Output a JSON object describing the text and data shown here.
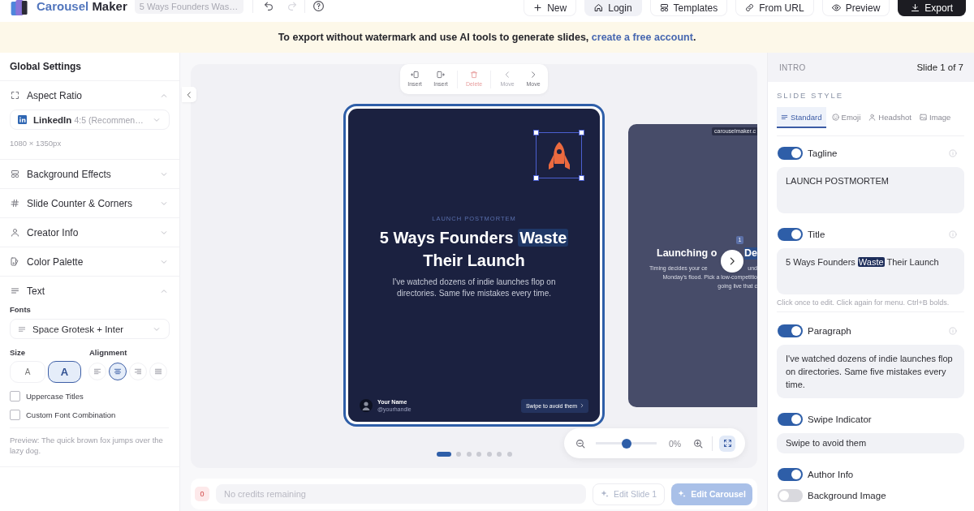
{
  "header": {
    "logo": {
      "accent": "Carousel",
      "rest": "Maker"
    },
    "document_title": "5 Ways Founders Was…",
    "history": [
      {
        "disabled": false
      },
      {
        "disabled": true
      }
    ],
    "actions": [
      {
        "label": "New",
        "kind": "outline"
      },
      {
        "label": "Login",
        "kind": "soft"
      },
      {
        "label": "Templates",
        "kind": "outline"
      },
      {
        "label": "From URL",
        "kind": "outline"
      },
      {
        "label": "Preview",
        "kind": "outline"
      },
      {
        "label": "Export",
        "kind": "primary"
      }
    ]
  },
  "banner": {
    "text": "To export without watermark and use AI tools to generate slides,",
    "link": "create a free account",
    "end": "."
  },
  "settings": {
    "title": "Global Settings",
    "sections": [
      {
        "label": "Aspect Ratio",
        "expanded": true,
        "platform": "LinkedIn",
        "ratio": "4:5 (Recommen…",
        "dimensions": "1080 × 1350px"
      },
      {
        "label": "Background Effects",
        "expanded": false
      },
      {
        "label": "Slide Counter & Corners",
        "expanded": false
      },
      {
        "label": "Creator Info",
        "expanded": false
      },
      {
        "label": "Color Palette",
        "expanded": false
      },
      {
        "label": "Text",
        "expanded": true,
        "fonts_label": "Fonts",
        "font": "Space Grotesk + Inter",
        "size_label": "Size",
        "sizes": [
          {
            "label": "A",
            "selected": false
          },
          {
            "label": "A",
            "selected": true
          }
        ],
        "alignment_label": "Alignment",
        "alignments": [
          {
            "selected": false
          },
          {
            "selected": true
          },
          {
            "selected": false
          },
          {
            "selected": false
          }
        ],
        "options": [
          {
            "label": "Uppercase Titles",
            "checked": false
          },
          {
            "label": "Custom Font Combination",
            "checked": false
          }
        ],
        "preview": "Preview: The quick brown fox jumps over the lazy dog."
      }
    ]
  },
  "canvas": {
    "toolbar": [
      {
        "label": "Insert",
        "kind": "normal",
        "disabled": false
      },
      {
        "label": "Insert",
        "kind": "normal",
        "disabled": false
      },
      {
        "label": "Delete",
        "kind": "danger",
        "disabled": true
      },
      {
        "label": "Move",
        "kind": "normal",
        "disabled": true
      },
      {
        "label": "Move",
        "kind": "normal",
        "disabled": false
      }
    ],
    "current_slide": {
      "selected": true,
      "emblem": {
        "selected": true
      },
      "tagline": "LAUNCH POSTMORTEM",
      "title": [
        {
          "text": "5 Ways Founders ",
          "highlighted": false
        },
        {
          "text": "Waste",
          "highlighted": true
        },
        {
          "text": " Their Launch",
          "highlighted": false
        }
      ],
      "paragraph": "I've watched dozens of indie launches flop on directories. Same five mistakes every time.",
      "author": {
        "name": "Your Name",
        "handle": "@yourhandle"
      },
      "swipe": "Swipe to avoid them"
    },
    "next_slide": {
      "selected": false,
      "badge": "carouselmaker.c",
      "counter": "1",
      "title": [
        {
          "text": "Launching o",
          "highlighted": false
        },
        {
          "text": "De",
          "highlighted": true
        }
      ],
      "lines": [
        [
          "Timing decides your ce",
          "und"
        ],
        [
          "Monday's flood. Pick a low-competitio"
        ],
        [
          "going live that c"
        ]
      ]
    },
    "pagination": [
      {
        "selected": true
      },
      {
        "selected": false
      },
      {
        "selected": false
      },
      {
        "selected": false
      },
      {
        "selected": false
      },
      {
        "selected": false
      },
      {
        "selected": false
      }
    ],
    "zoom": {
      "level": 0.5,
      "reading": "0%"
    }
  },
  "prompt_bar": {
    "credits": "0",
    "placeholder": "No credits remaining",
    "buttons": [
      {
        "label": "Edit Slide 1",
        "kind": "outline",
        "disabled": true
      },
      {
        "label": "Edit Carousel",
        "kind": "primary",
        "disabled": true
      }
    ]
  },
  "editor": {
    "section": "INTRO",
    "position": "Slide 1 of 7",
    "style_label": "SLIDE STYLE",
    "styles": [
      {
        "label": "Standard",
        "selected": true
      },
      {
        "label": "Emoji",
        "selected": false
      },
      {
        "label": "Headshot",
        "selected": false
      },
      {
        "label": "Image",
        "selected": false
      }
    ],
    "fields": [
      {
        "label": "Tagline",
        "on": true,
        "kind": "area",
        "value": "LAUNCH POSTMORTEM"
      },
      {
        "label": "Title",
        "on": true,
        "kind": "area",
        "value": [
          {
            "text": "5 Ways Founders ",
            "highlighted": false
          },
          {
            "text": "Waste",
            "highlighted": true
          },
          {
            "text": " Their Launch",
            "highlighted": false
          }
        ],
        "hint": "Click once to edit. Click again for menu. Ctrl+B bolds."
      },
      {
        "label": "Paragraph",
        "on": true,
        "kind": "area",
        "value": "I've watched dozens of indie launches flop on directories. Same five mistakes every time."
      },
      {
        "label": "Swipe Indicator",
        "on": true,
        "kind": "line",
        "value": "Swipe to avoid them"
      },
      {
        "label": "Author Info",
        "on": true,
        "kind": "toggle"
      },
      {
        "label": "Background Image",
        "on": false,
        "kind": "toggle"
      }
    ]
  }
}
